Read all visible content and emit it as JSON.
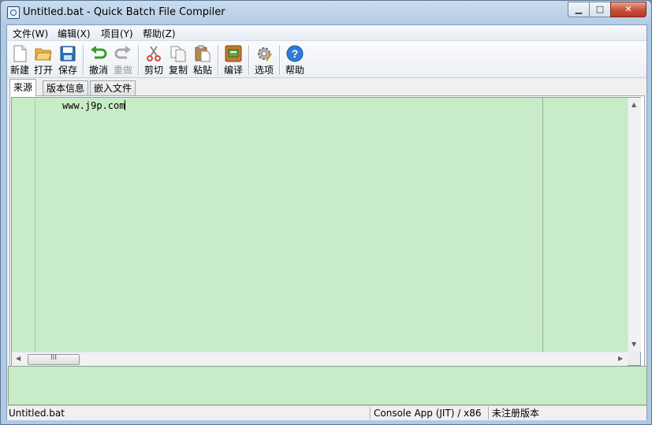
{
  "window": {
    "title": "Untitled.bat - Quick Batch File Compiler"
  },
  "menu": [
    {
      "label": "文件(W)"
    },
    {
      "label": "编辑(X)"
    },
    {
      "label": "项目(Y)"
    },
    {
      "label": "帮助(Z)"
    }
  ],
  "toolbar": [
    {
      "label": "新建",
      "icon": "new-file-icon",
      "enabled": true
    },
    {
      "label": "打开",
      "icon": "open-folder-icon",
      "enabled": true
    },
    {
      "label": "保存",
      "icon": "save-disk-icon",
      "enabled": true
    },
    {
      "label": "撤消",
      "icon": "undo-arrow-icon",
      "enabled": true
    },
    {
      "label": "重做",
      "icon": "redo-arrow-icon",
      "enabled": false
    },
    {
      "label": "剪切",
      "icon": "scissors-icon",
      "enabled": true
    },
    {
      "label": "复制",
      "icon": "copy-icon",
      "enabled": true
    },
    {
      "label": "粘贴",
      "icon": "paste-clipboard-icon",
      "enabled": true
    },
    {
      "label": "编译",
      "icon": "compile-box-icon",
      "enabled": true
    },
    {
      "label": "选项",
      "icon": "options-gear-icon",
      "enabled": true
    },
    {
      "label": "帮助",
      "icon": "help-question-icon",
      "enabled": true
    }
  ],
  "tabs": [
    {
      "label": "来源",
      "active": true
    },
    {
      "label": "版本信息",
      "active": false
    },
    {
      "label": "嵌入文件",
      "active": false
    }
  ],
  "editor": {
    "lines": [
      "www.j9p.com"
    ],
    "background": "#c7ecc7"
  },
  "scrollbar": {
    "thumb_grip": "III"
  },
  "status": {
    "filename": "Untitled.bat",
    "mode": "Console App (JIT) / x86",
    "registration": "未注册版本"
  },
  "colors": {
    "editor_bg": "#c7ecc7",
    "close_button": "#c7503a"
  }
}
